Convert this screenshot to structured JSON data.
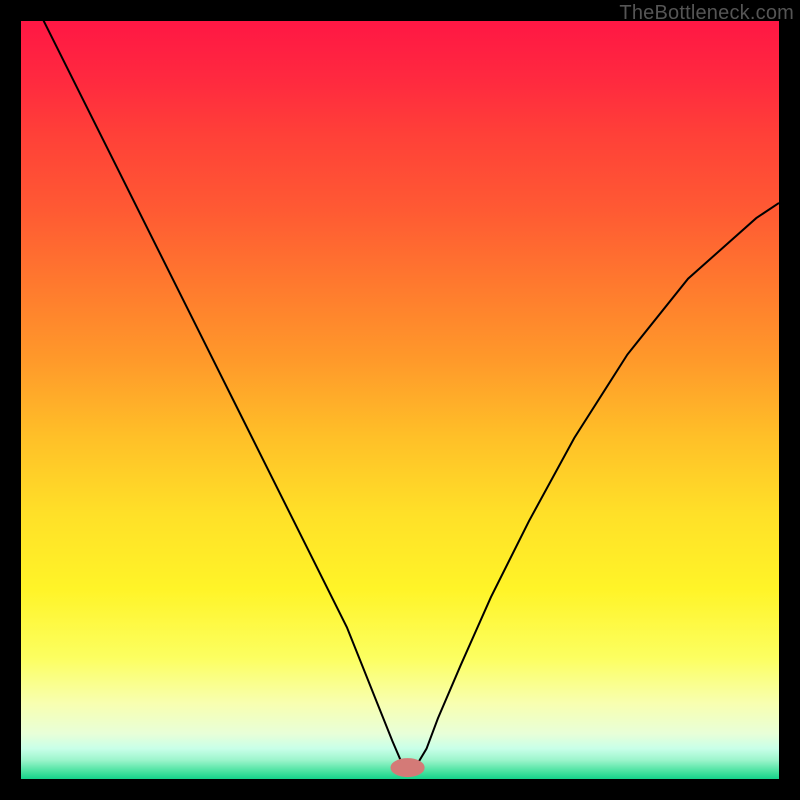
{
  "watermark": "TheBottleneck.com",
  "colors": {
    "frame": "#000000",
    "curve": "#000000",
    "marker_fill": "#d47a77",
    "marker_stroke": "#d47a77"
  },
  "chart_data": {
    "type": "line",
    "title": "",
    "xlabel": "",
    "ylabel": "",
    "xlim": [
      0,
      100
    ],
    "ylim": [
      0,
      100
    ],
    "grid": false,
    "legend": false,
    "series": [
      {
        "name": "bottleneck-curve",
        "x": [
          0,
          3,
          8,
          13,
          18,
          23,
          28,
          33,
          38,
          43,
          45,
          47,
          49,
          50.5,
          52,
          53.5,
          55,
          58,
          62,
          67,
          73,
          80,
          88,
          97,
          100
        ],
        "y": [
          108,
          100,
          90,
          80,
          70,
          60,
          50,
          40,
          30,
          20,
          15,
          10,
          5,
          1.5,
          1.5,
          4,
          8,
          15,
          24,
          34,
          45,
          56,
          66,
          74,
          76
        ]
      }
    ],
    "marker": {
      "x": 51,
      "y": 1.5,
      "rx": 2.2,
      "ry": 1.2
    },
    "gradient_stops": [
      {
        "pos": 0,
        "color": "#ff1744"
      },
      {
        "pos": 0.25,
        "color": "#ff5a33"
      },
      {
        "pos": 0.55,
        "color": "#ffc028"
      },
      {
        "pos": 0.8,
        "color": "#fff428"
      },
      {
        "pos": 0.95,
        "color": "#e8ffd8"
      },
      {
        "pos": 1.0,
        "color": "#14d28a"
      }
    ]
  }
}
